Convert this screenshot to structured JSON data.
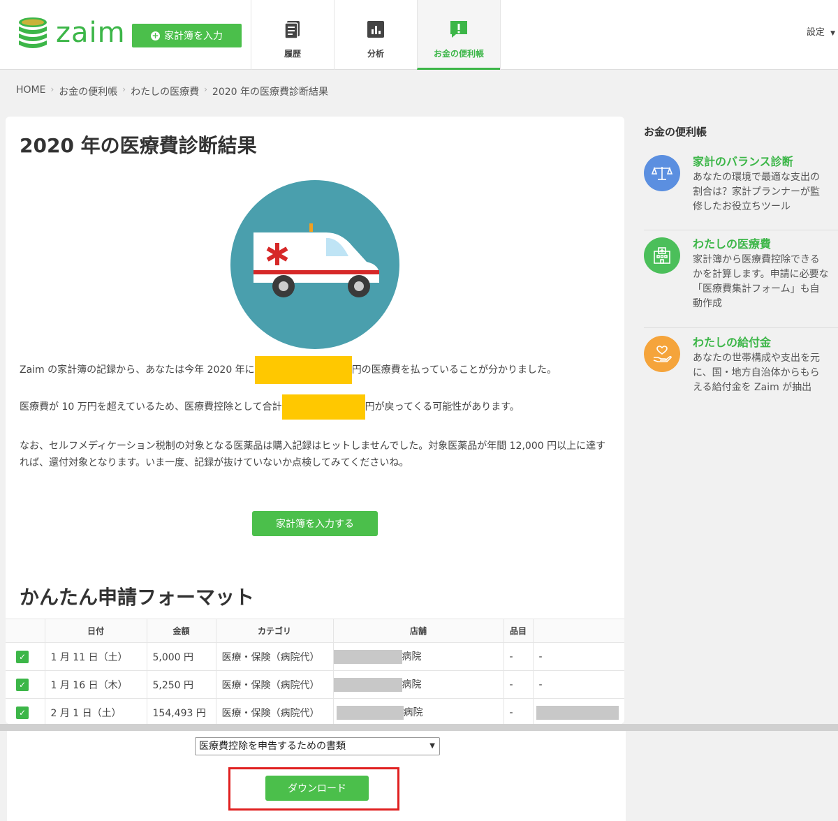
{
  "header": {
    "logo_text": "zaim",
    "input_button": "家計簿を入力",
    "tabs": [
      {
        "label": "履歴",
        "icon": "history-icon"
      },
      {
        "label": "分析",
        "icon": "chart-icon"
      },
      {
        "label": "お金の便利帳",
        "icon": "notice-icon",
        "active": true
      }
    ],
    "settings": "設定"
  },
  "breadcrumb": [
    "HOME",
    "お金の便利帳",
    "わたしの医療費",
    "2020 年の医療費診断結果"
  ],
  "main": {
    "title": "2020 年の医療費診断結果",
    "para1_before": "Zaim の家計簿の記録から、あなたは今年 2020 年に",
    "para1_after": "円の医療費を払っていることが分かりました。",
    "para2_before": "医療費が 10 万円を超えているため、医療費控除として合計",
    "para2_after": "円が戻ってくる可能性があります。",
    "para3": "なお、セルフメディケーション税制の対象となる医薬品は購入記録はヒットしませんでした。対象医薬品が年間 12,000 円以上に達すれば、還付対象となります。いま一度、記録が抜けていないか点検してみてくださいね。",
    "input_button": "家計簿を入力する",
    "form_title": "かんたん申請フォーマット"
  },
  "table": {
    "headers": [
      "",
      "日付",
      "金額",
      "カテゴリ",
      "店舗",
      "品目",
      ""
    ],
    "rows": [
      {
        "date": "1 月 11 日（土）",
        "amount": "5,000 円",
        "category": "医療・保険（病院代）",
        "store_suffix": "病院",
        "item": "-",
        "memo": "-"
      },
      {
        "date": "1 月 16 日（木）",
        "amount": "5,250 円",
        "category": "医療・保険（病院代）",
        "store_suffix": "病院",
        "item": "-",
        "memo": "-"
      },
      {
        "date": "2 月 1 日（土）",
        "amount": "154,493 円",
        "category": "医療・保険（病院代）",
        "store_suffix": "病院",
        "item": "-",
        "memo": ""
      }
    ]
  },
  "download": {
    "select_value": "医療費控除を申告するための書類",
    "button": "ダウンロード"
  },
  "sidebar": {
    "title": "お金の便利帳",
    "items": [
      {
        "name": "家計のバランス診断",
        "desc": "あなたの環境で最適な支出の割合は？家計プランナーが監修したお役立ちツール",
        "icon": "balance-scale-icon",
        "color": "#5b8fe0"
      },
      {
        "name": "わたしの医療費",
        "desc": "家計簿から医療費控除できるかを計算します。申請に必要な「医療費集計フォーム」も自動作成",
        "icon": "hospital-icon",
        "color": "#4bbf5a"
      },
      {
        "name": "わたしの給付金",
        "desc": "あなたの世帯構成や支出を元に、国・地方自治体からもらえる給付金を Zaim が抽出",
        "icon": "heart-hand-icon",
        "color": "#f5a43b"
      }
    ]
  },
  "colors": {
    "accent": "#3cb648",
    "redaction": "#ffc800",
    "highlight_border": "#e02020"
  }
}
